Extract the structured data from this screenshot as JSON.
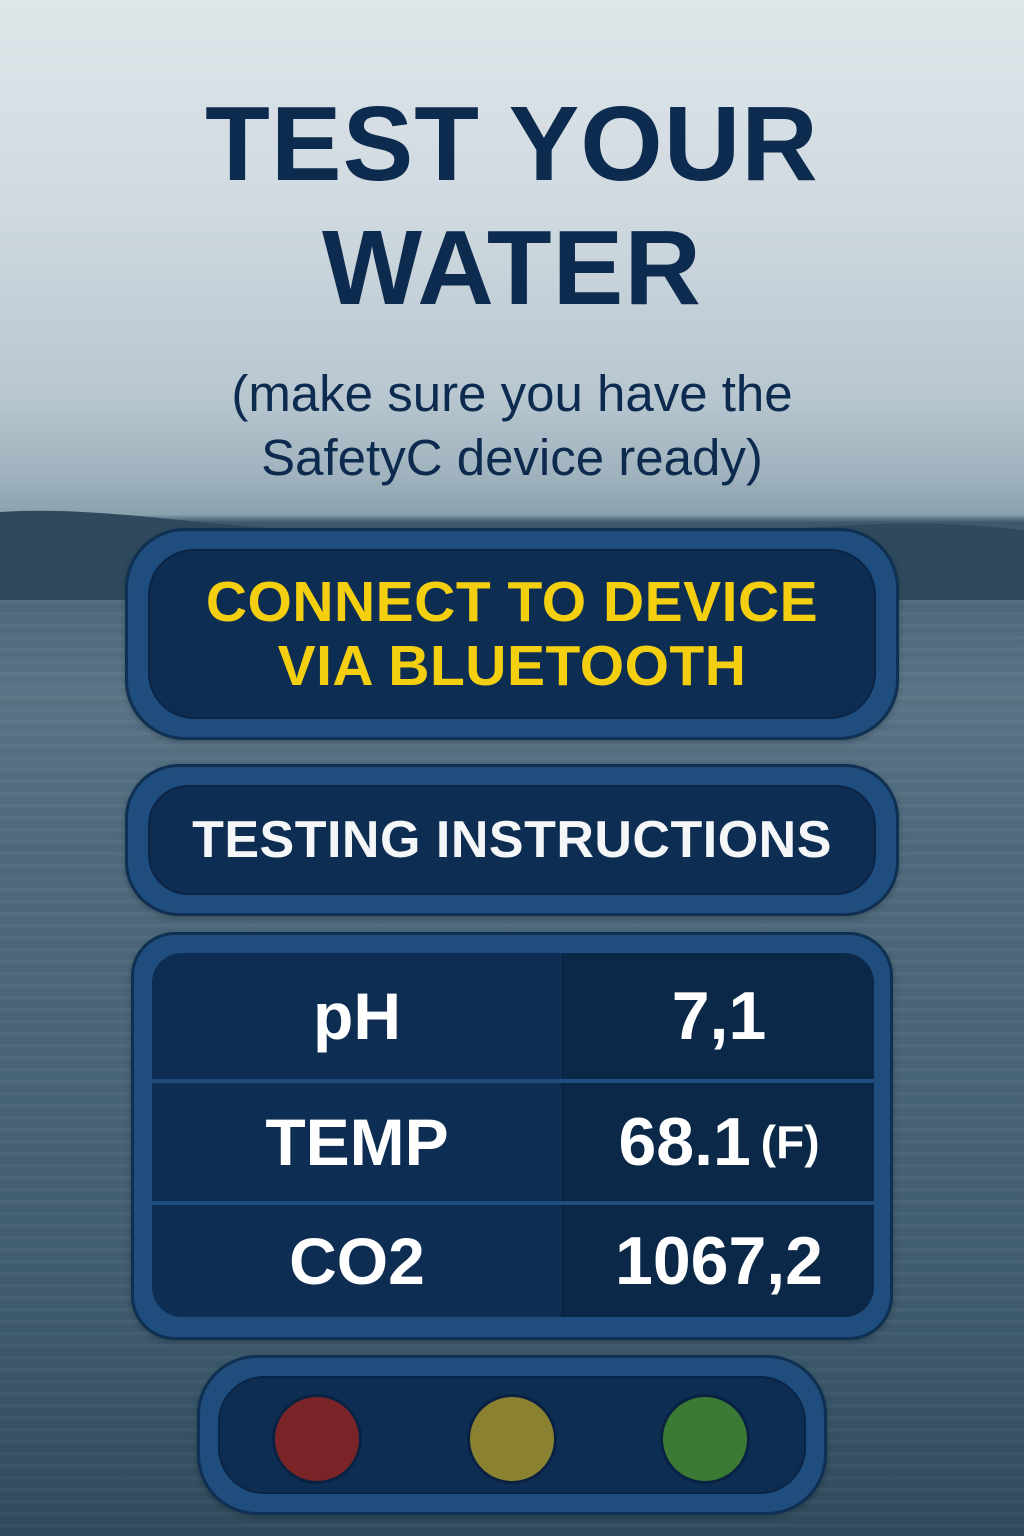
{
  "header": {
    "title_line1": "TEST YOUR",
    "title_line2": "WATER",
    "subtitle_line1": "(make sure you have the",
    "subtitle_line2": "SafetyC device ready)"
  },
  "connect_button": {
    "label_line1": "CONNECT TO DEVICE",
    "label_line2": "VIA BLUETOOTH"
  },
  "instructions_button": {
    "label": "TESTING INSTRUCTIONS"
  },
  "readings": [
    {
      "name": "pH",
      "value": "7,1",
      "unit": ""
    },
    {
      "name": "TEMP",
      "value": "68.1",
      "unit": "(F)"
    },
    {
      "name": "CO2",
      "value": "1067,2",
      "unit": ""
    }
  ],
  "status_lights": [
    {
      "name": "red",
      "color": "#7a2428"
    },
    {
      "name": "yellow",
      "color": "#8a8230"
    },
    {
      "name": "green",
      "color": "#3b7a35"
    }
  ],
  "colors": {
    "title_text": "#0d2a4f",
    "panel_border": "#1f4d7d",
    "panel_fill": "#0e2d52",
    "connect_text": "#f3cf10",
    "reading_text": "#ffffff"
  }
}
